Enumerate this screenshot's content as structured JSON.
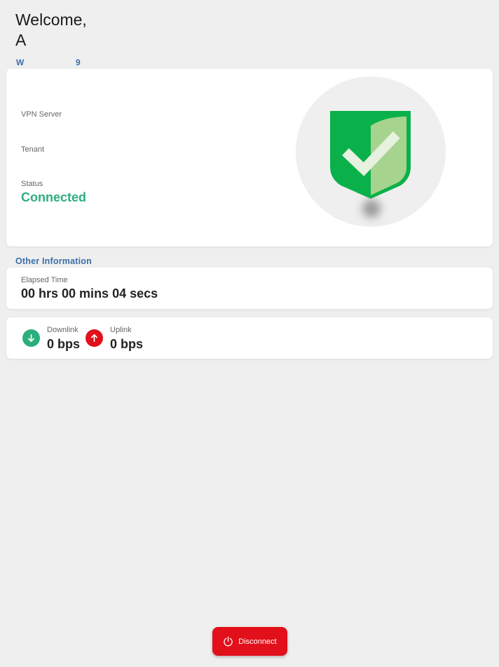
{
  "header": {
    "welcome": "Welcome,",
    "name": "A",
    "sub_left": "W",
    "sub_right": "9"
  },
  "connection": {
    "vpn_server_label": "VPN Server",
    "tenant_label": "Tenant",
    "status_label": "Status",
    "status_value": "Connected",
    "status_color": "#2bae7d",
    "shield_icon": "shield-check-icon"
  },
  "other_info": {
    "title": "Other Information",
    "elapsed_label": "Elapsed Time",
    "elapsed_value": "00 hrs 00 mins 04 secs",
    "downlink_label": "Downlink",
    "downlink_value": "0 bps",
    "downlink_icon": "arrow-down-icon",
    "downlink_color": "#2bae7d",
    "uplink_label": "Uplink",
    "uplink_value": "0 bps",
    "uplink_icon": "arrow-up-icon",
    "uplink_color": "#e2101a"
  },
  "actions": {
    "disconnect_label": "Disconnect",
    "disconnect_icon": "power-icon",
    "accent": "#e2101a"
  }
}
